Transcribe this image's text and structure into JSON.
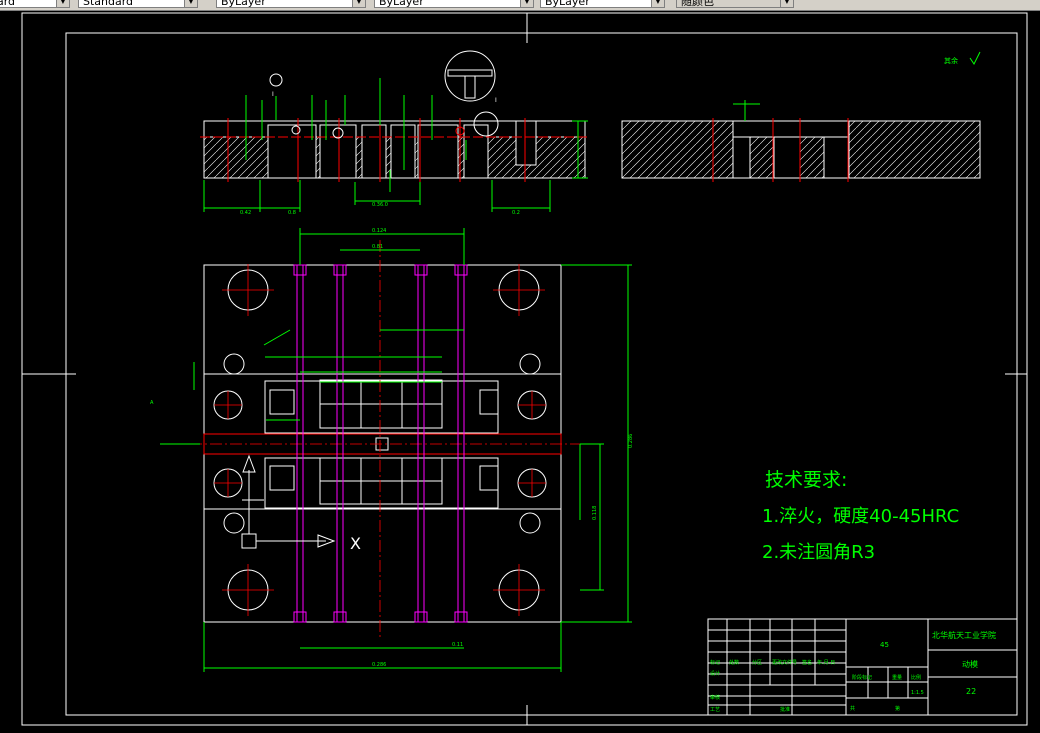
{
  "toolbar": {
    "text_style": "Standard",
    "layer": "ByLayer",
    "color": "ByLayer",
    "linetype": "ByLayer",
    "plot_style": "随颜色"
  },
  "drawing": {
    "tech_title": "技术要求:",
    "req_1": "1.淬火，硬度40-45HRC",
    "req_2": "2.未注圆角R3",
    "roughness_note": "其余",
    "view_x_label": "X",
    "section_label": "A",
    "title_block": {
      "material": "45",
      "school": "北华航天工业学院",
      "part_name": "动模",
      "number": "22",
      "scale": "1:1.5",
      "rows": [
        "标记",
        "处数",
        "分区",
        "更改文件号",
        "签名",
        "年.月.日"
      ],
      "design": "设计",
      "check": "审核",
      "process": "工艺",
      "approve": "批准",
      "stage": "阶段标记",
      "weight": "重量",
      "ratio": "比例",
      "sheets": "共",
      "sheet": "第"
    }
  },
  "colors": {
    "outline": "#ffffff",
    "dimension": "#00ff00",
    "center": "#ff0000",
    "pin": "#ff00ff",
    "text": "#00ff00",
    "hatch": "#ffffff"
  }
}
